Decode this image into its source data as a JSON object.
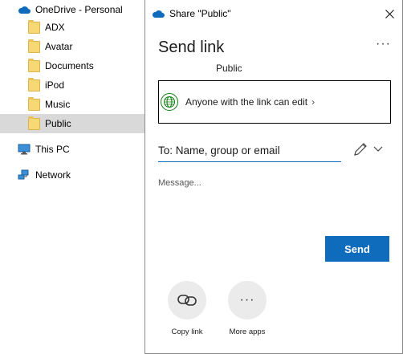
{
  "nav": {
    "items": [
      {
        "label": "OneDrive - Personal",
        "icon": "onedrive-cloud-icon"
      },
      {
        "label": "ADX",
        "icon": "folder-icon"
      },
      {
        "label": "Avatar",
        "icon": "folder-icon"
      },
      {
        "label": "Documents",
        "icon": "folder-icon"
      },
      {
        "label": "iPod",
        "icon": "folder-icon"
      },
      {
        "label": "Music",
        "icon": "folder-icon"
      },
      {
        "label": "Public",
        "icon": "folder-icon",
        "selected": true
      },
      {
        "label": "This PC",
        "icon": "computer-icon"
      },
      {
        "label": "Network",
        "icon": "network-icon"
      }
    ]
  },
  "dialog": {
    "title": "Share \"Public\"",
    "heading": "Send link",
    "more_label": "···",
    "item_name": "Public",
    "permission": "Anyone with the link can edit",
    "permission_chevron": "›",
    "to_placeholder": "To: Name, group or email",
    "message_placeholder": "Message...",
    "send_label": "Send",
    "copy_link_label": "Copy link",
    "more_apps_label": "More apps",
    "more_apps_glyph": "···"
  },
  "colors": {
    "accent": "#0f6cbd",
    "selected_bg": "#d9d9d9",
    "globe": "#107c10",
    "folder": "#f8d775"
  }
}
